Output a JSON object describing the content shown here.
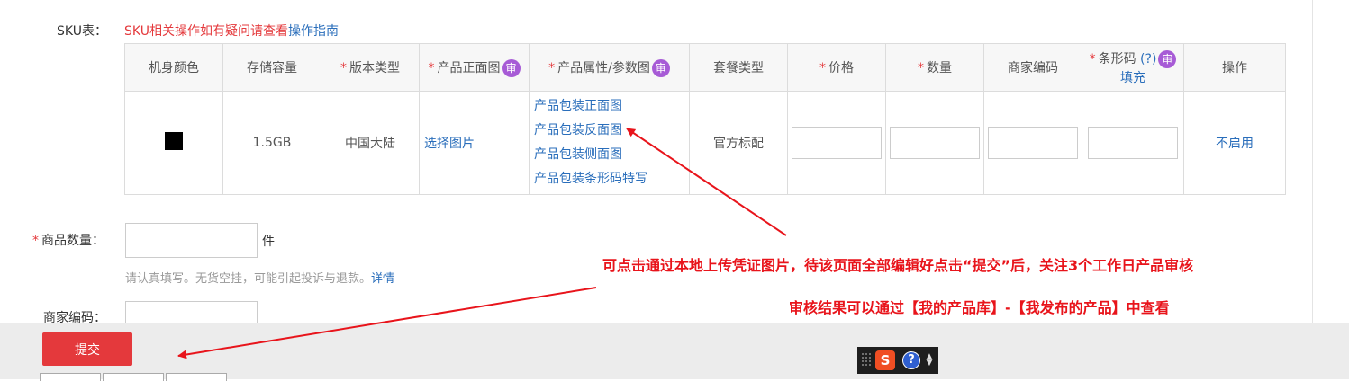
{
  "sku": {
    "label": "SKU表：",
    "hint": "SKU相关操作如有疑问请查看",
    "guide_link": "操作指南",
    "headers": {
      "color": "机身颜色",
      "storage": "存储容量",
      "version": "版本类型",
      "front_image": "产品正面图",
      "attr_image": "产品属性/参数图",
      "package": "套餐类型",
      "price": "价格",
      "quantity": "数量",
      "merchant_code": "商家编码",
      "barcode": "条形码",
      "barcode_help": "(?)",
      "barcode_fill": "填充",
      "action": "操作"
    },
    "badge": "审",
    "required_mark": "*",
    "row": {
      "color": "black",
      "storage": "1.5GB",
      "version": "中国大陆",
      "select_image": "选择图片",
      "attr_links": [
        "产品包装正面图",
        "产品包装反面图",
        "产品包装侧面图",
        "产品包装条形码特写"
      ],
      "package": "官方标配",
      "action": "不启用"
    }
  },
  "goods_count": {
    "label": "商品数量：",
    "unit": "件",
    "hint": "请认真填写。无货空挂，可能引起投诉与退款。",
    "detail_link": "详情"
  },
  "merchant_code": {
    "label": "商家编码："
  },
  "footer": {
    "submit_label": "提交"
  },
  "annotations": {
    "line1": "可点击通过本地上传凭证图片，待该页面全部编辑好点击“提交”后，关注3个工作日产品审核",
    "line2": "审核结果可以通过【我的产品库】-【我发布的产品】中查看"
  },
  "ime": {
    "logo": "S",
    "help": "?"
  },
  "colors": {
    "accent_red": "#e4393c",
    "link_blue": "#2a6ebb",
    "badge_purple": "#a75bd6",
    "annotation_red": "#e8141b"
  }
}
